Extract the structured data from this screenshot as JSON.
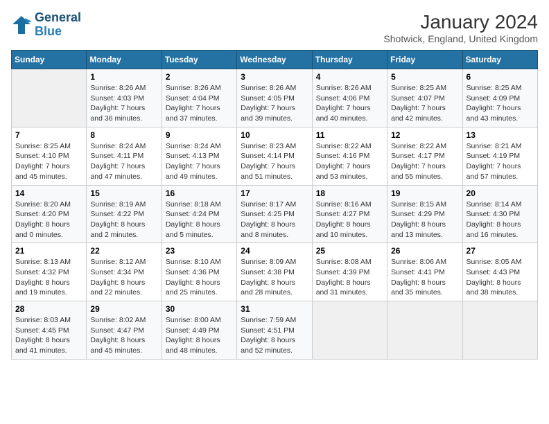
{
  "logo": {
    "line1": "General",
    "line2": "Blue"
  },
  "title": "January 2024",
  "subtitle": "Shotwick, England, United Kingdom",
  "days_header": [
    "Sunday",
    "Monday",
    "Tuesday",
    "Wednesday",
    "Thursday",
    "Friday",
    "Saturday"
  ],
  "weeks": [
    [
      {
        "num": "",
        "info": ""
      },
      {
        "num": "1",
        "info": "Sunrise: 8:26 AM\nSunset: 4:03 PM\nDaylight: 7 hours\nand 36 minutes."
      },
      {
        "num": "2",
        "info": "Sunrise: 8:26 AM\nSunset: 4:04 PM\nDaylight: 7 hours\nand 37 minutes."
      },
      {
        "num": "3",
        "info": "Sunrise: 8:26 AM\nSunset: 4:05 PM\nDaylight: 7 hours\nand 39 minutes."
      },
      {
        "num": "4",
        "info": "Sunrise: 8:26 AM\nSunset: 4:06 PM\nDaylight: 7 hours\nand 40 minutes."
      },
      {
        "num": "5",
        "info": "Sunrise: 8:25 AM\nSunset: 4:07 PM\nDaylight: 7 hours\nand 42 minutes."
      },
      {
        "num": "6",
        "info": "Sunrise: 8:25 AM\nSunset: 4:09 PM\nDaylight: 7 hours\nand 43 minutes."
      }
    ],
    [
      {
        "num": "7",
        "info": "Sunrise: 8:25 AM\nSunset: 4:10 PM\nDaylight: 7 hours\nand 45 minutes."
      },
      {
        "num": "8",
        "info": "Sunrise: 8:24 AM\nSunset: 4:11 PM\nDaylight: 7 hours\nand 47 minutes."
      },
      {
        "num": "9",
        "info": "Sunrise: 8:24 AM\nSunset: 4:13 PM\nDaylight: 7 hours\nand 49 minutes."
      },
      {
        "num": "10",
        "info": "Sunrise: 8:23 AM\nSunset: 4:14 PM\nDaylight: 7 hours\nand 51 minutes."
      },
      {
        "num": "11",
        "info": "Sunrise: 8:22 AM\nSunset: 4:16 PM\nDaylight: 7 hours\nand 53 minutes."
      },
      {
        "num": "12",
        "info": "Sunrise: 8:22 AM\nSunset: 4:17 PM\nDaylight: 7 hours\nand 55 minutes."
      },
      {
        "num": "13",
        "info": "Sunrise: 8:21 AM\nSunset: 4:19 PM\nDaylight: 7 hours\nand 57 minutes."
      }
    ],
    [
      {
        "num": "14",
        "info": "Sunrise: 8:20 AM\nSunset: 4:20 PM\nDaylight: 8 hours\nand 0 minutes."
      },
      {
        "num": "15",
        "info": "Sunrise: 8:19 AM\nSunset: 4:22 PM\nDaylight: 8 hours\nand 2 minutes."
      },
      {
        "num": "16",
        "info": "Sunrise: 8:18 AM\nSunset: 4:24 PM\nDaylight: 8 hours\nand 5 minutes."
      },
      {
        "num": "17",
        "info": "Sunrise: 8:17 AM\nSunset: 4:25 PM\nDaylight: 8 hours\nand 8 minutes."
      },
      {
        "num": "18",
        "info": "Sunrise: 8:16 AM\nSunset: 4:27 PM\nDaylight: 8 hours\nand 10 minutes."
      },
      {
        "num": "19",
        "info": "Sunrise: 8:15 AM\nSunset: 4:29 PM\nDaylight: 8 hours\nand 13 minutes."
      },
      {
        "num": "20",
        "info": "Sunrise: 8:14 AM\nSunset: 4:30 PM\nDaylight: 8 hours\nand 16 minutes."
      }
    ],
    [
      {
        "num": "21",
        "info": "Sunrise: 8:13 AM\nSunset: 4:32 PM\nDaylight: 8 hours\nand 19 minutes."
      },
      {
        "num": "22",
        "info": "Sunrise: 8:12 AM\nSunset: 4:34 PM\nDaylight: 8 hours\nand 22 minutes."
      },
      {
        "num": "23",
        "info": "Sunrise: 8:10 AM\nSunset: 4:36 PM\nDaylight: 8 hours\nand 25 minutes."
      },
      {
        "num": "24",
        "info": "Sunrise: 8:09 AM\nSunset: 4:38 PM\nDaylight: 8 hours\nand 28 minutes."
      },
      {
        "num": "25",
        "info": "Sunrise: 8:08 AM\nSunset: 4:39 PM\nDaylight: 8 hours\nand 31 minutes."
      },
      {
        "num": "26",
        "info": "Sunrise: 8:06 AM\nSunset: 4:41 PM\nDaylight: 8 hours\nand 35 minutes."
      },
      {
        "num": "27",
        "info": "Sunrise: 8:05 AM\nSunset: 4:43 PM\nDaylight: 8 hours\nand 38 minutes."
      }
    ],
    [
      {
        "num": "28",
        "info": "Sunrise: 8:03 AM\nSunset: 4:45 PM\nDaylight: 8 hours\nand 41 minutes."
      },
      {
        "num": "29",
        "info": "Sunrise: 8:02 AM\nSunset: 4:47 PM\nDaylight: 8 hours\nand 45 minutes."
      },
      {
        "num": "30",
        "info": "Sunrise: 8:00 AM\nSunset: 4:49 PM\nDaylight: 8 hours\nand 48 minutes."
      },
      {
        "num": "31",
        "info": "Sunrise: 7:59 AM\nSunset: 4:51 PM\nDaylight: 8 hours\nand 52 minutes."
      },
      {
        "num": "",
        "info": ""
      },
      {
        "num": "",
        "info": ""
      },
      {
        "num": "",
        "info": ""
      }
    ]
  ]
}
